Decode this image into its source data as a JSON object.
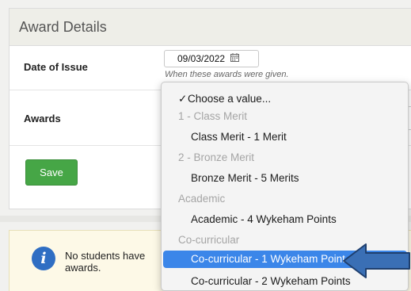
{
  "panel": {
    "title": "Award Details",
    "date_label": "Date of Issue",
    "date_value": "09/03/2022",
    "date_help": "When these awards were given.",
    "awards_label": "Awards",
    "save_label": "Save"
  },
  "alert": {
    "text": "No students have awards."
  },
  "dropdown": {
    "items": [
      {
        "kind": "selected",
        "label": "Choose a value..."
      },
      {
        "kind": "group",
        "label": "1 - Class Merit"
      },
      {
        "kind": "option",
        "label": "Class Merit - 1 Merit"
      },
      {
        "kind": "group",
        "label": "2 - Bronze Merit"
      },
      {
        "kind": "option",
        "label": "Bronze Merit - 5 Merits"
      },
      {
        "kind": "group",
        "label": "Academic"
      },
      {
        "kind": "option",
        "label": "Academic - 4 Wykeham Points"
      },
      {
        "kind": "group",
        "label": "Co-curricular"
      },
      {
        "kind": "highlighted",
        "label": "Co-curricular - 1 Wykeham Point"
      },
      {
        "kind": "option",
        "label": "Co-curricular - 2 Wykeham Points"
      }
    ],
    "check_glyph": "✓"
  },
  "colors": {
    "highlight": "#3b86e9",
    "save_button": "#46a646",
    "info_icon": "#2f6ec3",
    "arrow": "#3a6fb5"
  },
  "icons": {
    "calendar": "calendar-icon",
    "info": "info-icon",
    "pointer": "arrow-pointer-icon"
  }
}
